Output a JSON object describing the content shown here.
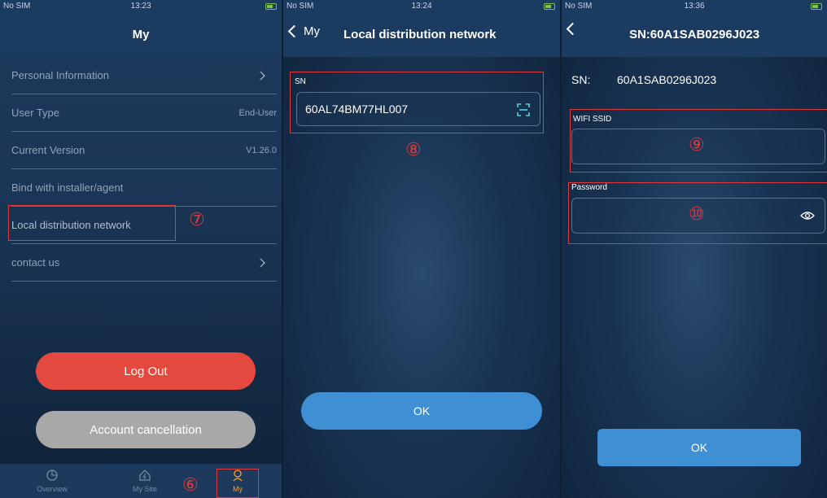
{
  "panel1": {
    "status": {
      "carrier": "No SIM",
      "time": "13:23"
    },
    "title": "My",
    "menu": [
      {
        "label": "Personal Information",
        "value": ""
      },
      {
        "label": "User Type",
        "value": "End-User"
      },
      {
        "label": "Current Version",
        "value": "V1.26.0"
      },
      {
        "label": "Bind with installer/agent",
        "value": ""
      },
      {
        "label": "Local distribution network",
        "value": ""
      },
      {
        "label": "contact us",
        "value": ""
      }
    ],
    "logout_label": "Log Out",
    "cancel_label": "Account cancellation",
    "tabs": [
      {
        "label": "Overview",
        "icon": "pie-chart-icon"
      },
      {
        "label": "My Site",
        "icon": "home-icon"
      },
      {
        "label": "My",
        "icon": "user-icon"
      }
    ],
    "annotations": {
      "tab": "⑥",
      "menu": "⑦"
    }
  },
  "panel2": {
    "status": {
      "carrier": "No SIM",
      "time": "13:24"
    },
    "back_label": "My",
    "title": "Local distribution network",
    "sn_label": "SN",
    "sn_value": "60AL74BM77HL007",
    "ok_label": "OK",
    "annotation": "⑧"
  },
  "panel3": {
    "status": {
      "carrier": "No SIM",
      "time": "13:36"
    },
    "title": "SN:60A1SAB0296J023",
    "sn_label": "SN:",
    "sn_value": "60A1SAB0296J023",
    "ssid_label": "WIFI SSID",
    "ssid_value": "",
    "password_label": "Password",
    "password_value": "",
    "ok_label": "OK",
    "annotations": {
      "ssid": "⑨",
      "password": "⑩"
    }
  },
  "colors": {
    "accent": "#3f8fd4",
    "logout": "#e3493f",
    "annotation": "#e0393a",
    "active_tab": "#f0a33a"
  }
}
